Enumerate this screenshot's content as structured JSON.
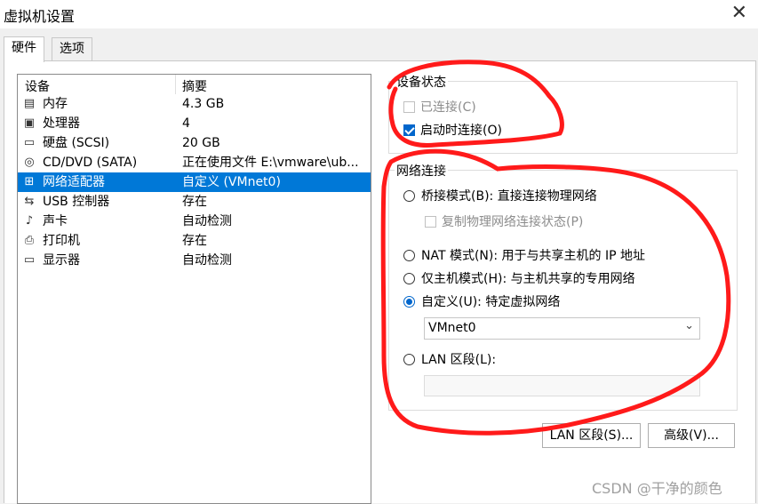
{
  "window": {
    "title": "虚拟机设置",
    "close_icon": "close-icon"
  },
  "tabs": [
    {
      "label": "硬件",
      "active": true
    },
    {
      "label": "选项",
      "active": false
    }
  ],
  "device_list": {
    "columns": [
      "设备",
      "摘要"
    ],
    "rows": [
      {
        "icon": "memory-icon",
        "name": "内存",
        "summary": "4.3 GB",
        "selected": false
      },
      {
        "icon": "cpu-icon",
        "name": "处理器",
        "summary": "4",
        "selected": false
      },
      {
        "icon": "harddisk-icon",
        "name": "硬盘 (SCSI)",
        "summary": "20 GB",
        "selected": false
      },
      {
        "icon": "cd-dvd-icon",
        "name": "CD/DVD (SATA)",
        "summary": "正在使用文件 E:\\vmware\\ub...",
        "selected": false
      },
      {
        "icon": "network-adapter-icon",
        "name": "网络适配器",
        "summary": "自定义 (VMnet0)",
        "selected": true
      },
      {
        "icon": "usb-icon",
        "name": "USB 控制器",
        "summary": "存在",
        "selected": false
      },
      {
        "icon": "speaker-icon",
        "name": "声卡",
        "summary": "自动检测",
        "selected": false
      },
      {
        "icon": "printer-icon",
        "name": "打印机",
        "summary": "存在",
        "selected": false
      },
      {
        "icon": "monitor-icon",
        "name": "显示器",
        "summary": "自动检测",
        "selected": false
      }
    ]
  },
  "device_status": {
    "label": "设备状态",
    "connected": {
      "label": "已连接(C)",
      "checked": false,
      "enabled": false
    },
    "connect_at_power_on": {
      "label": "启动时连接(O)",
      "checked": true,
      "enabled": true
    }
  },
  "network_connection": {
    "label": "网络连接",
    "bridged": {
      "label": "桥接模式(B): 直接连接物理网络",
      "selected": false
    },
    "replicate": {
      "label": "复制物理网络连接状态(P)",
      "checked": false,
      "enabled": false
    },
    "nat": {
      "label": "NAT 模式(N): 用于与共享主机的 IP 地址",
      "selected": false
    },
    "host_only": {
      "label": "仅主机模式(H): 与主机共享的专用网络",
      "selected": false
    },
    "custom": {
      "label": "自定义(U): 特定虚拟网络",
      "selected": true
    },
    "custom_network": "VMnet0",
    "lan_segment": {
      "label": "LAN 区段(L):",
      "selected": false,
      "value": ""
    }
  },
  "buttons": {
    "lan_segments": "LAN 区段(S)...",
    "advanced": "高级(V)..."
  },
  "watermark": "CSDN @干净的颜色",
  "colors": {
    "selection": "#0078d7",
    "accent": "#0066cc",
    "annotation": "#ff1a1a"
  }
}
